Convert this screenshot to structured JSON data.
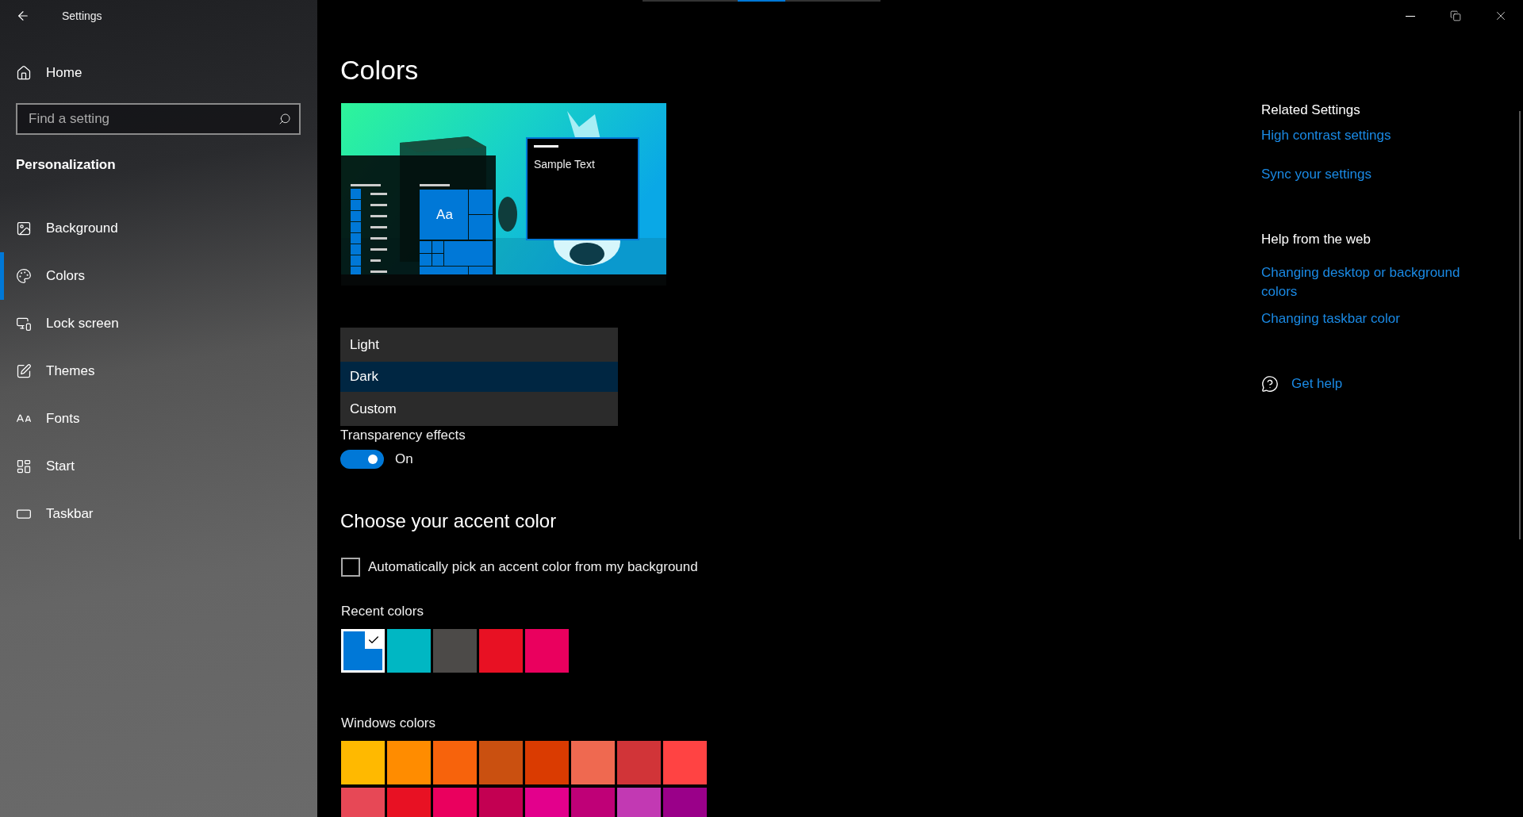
{
  "window": {
    "title": "Settings"
  },
  "sidebar": {
    "home": "Home",
    "search": {
      "placeholder": "Find a setting"
    },
    "section": "Personalization",
    "items": [
      {
        "label": "Background",
        "selected": false
      },
      {
        "label": "Colors",
        "selected": true
      },
      {
        "label": "Lock screen",
        "selected": false
      },
      {
        "label": "Themes",
        "selected": false
      },
      {
        "label": "Fonts",
        "selected": false
      },
      {
        "label": "Start",
        "selected": false
      },
      {
        "label": "Taskbar",
        "selected": false
      }
    ]
  },
  "main": {
    "title": "Colors",
    "preview": {
      "tile_label": "Aa",
      "sample_text": "Sample Text"
    },
    "mode_menu": {
      "options": [
        {
          "label": "Light",
          "selected": false
        },
        {
          "label": "Dark",
          "selected": true
        },
        {
          "label": "Custom",
          "selected": false
        }
      ]
    },
    "transparency": {
      "label": "Transparency effects",
      "on": true,
      "state_text": "On"
    },
    "accent": {
      "heading": "Choose your accent color",
      "auto_pick": {
        "label": "Automatically pick an accent color from my background",
        "checked": false
      },
      "recent": {
        "label": "Recent colors",
        "swatches": [
          {
            "color": "#0078d7",
            "selected": true
          },
          {
            "color": "#00b7c3",
            "selected": false
          },
          {
            "color": "#4c4a48",
            "selected": false
          },
          {
            "color": "#e81123",
            "selected": false
          },
          {
            "color": "#ea005e",
            "selected": false
          }
        ]
      },
      "windows": {
        "label": "Windows colors",
        "swatches": [
          {
            "color": "#ffb900",
            "selected": false
          },
          {
            "color": "#ff8c00",
            "selected": false
          },
          {
            "color": "#f7630c",
            "selected": false
          },
          {
            "color": "#ca5010",
            "selected": false
          },
          {
            "color": "#da3b01",
            "selected": false
          },
          {
            "color": "#ef6950",
            "selected": false
          },
          {
            "color": "#d13438",
            "selected": false
          },
          {
            "color": "#ff4343",
            "selected": false
          },
          {
            "color": "#e74856",
            "selected": false
          },
          {
            "color": "#e81123",
            "selected": false
          },
          {
            "color": "#ea005e",
            "selected": false
          },
          {
            "color": "#c30052",
            "selected": false
          },
          {
            "color": "#e3008c",
            "selected": false
          },
          {
            "color": "#bf0077",
            "selected": false
          },
          {
            "color": "#c239b3",
            "selected": false
          },
          {
            "color": "#9a0089",
            "selected": false
          }
        ]
      }
    }
  },
  "aside": {
    "related": {
      "heading": "Related Settings",
      "links": [
        "High contrast settings",
        "Sync your settings"
      ]
    },
    "web": {
      "heading": "Help from the web",
      "links": [
        "Changing desktop or background colors",
        "Changing taskbar color"
      ]
    },
    "get_help": "Get help"
  }
}
